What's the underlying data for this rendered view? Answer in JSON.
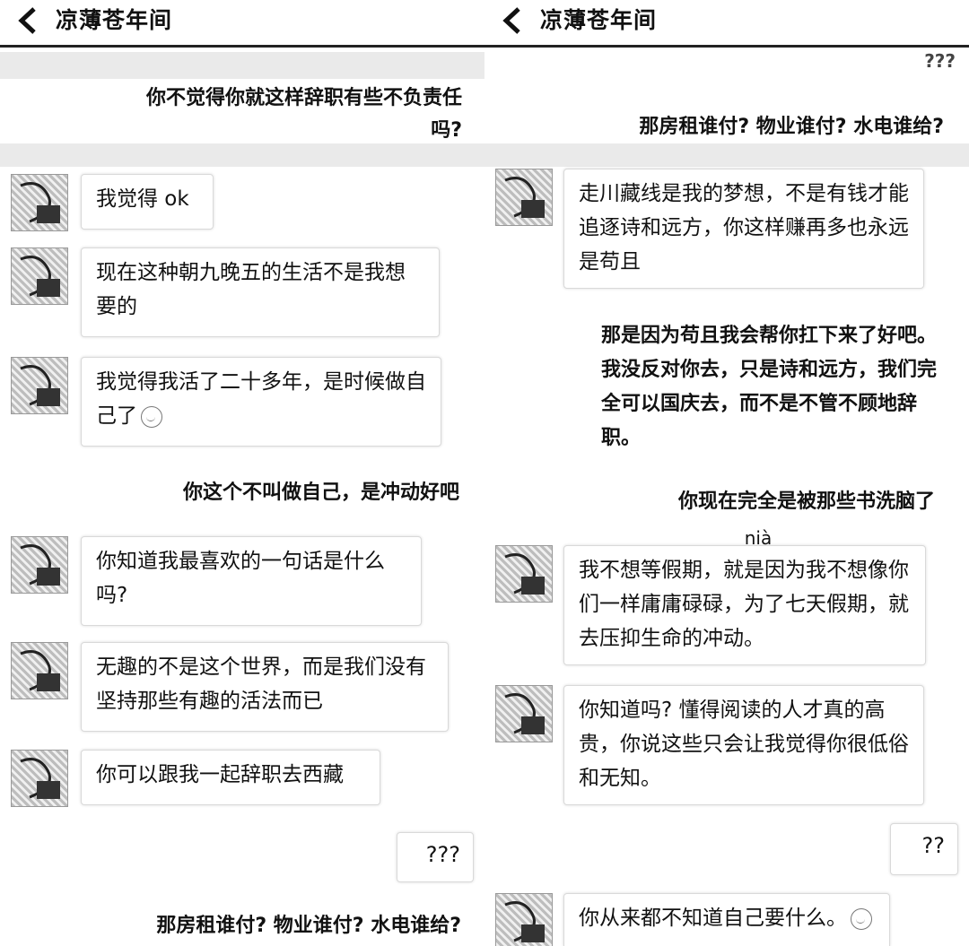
{
  "left_panel": {
    "header": {
      "title": "凉薄苍年间"
    },
    "messages": {
      "s1": "你不觉得你就这样辞职有些不负责任吗?",
      "r1": "我觉得 ok",
      "r2": "现在这种朝九晚五的生活不是我想要的",
      "r3": "我觉得我活了二十多年，是时候做自己了",
      "s2": "你这个不叫做自己，是冲动好吧",
      "r4": "你知道我最喜欢的一句话是什么吗?",
      "r5": "无趣的不是这个世界，而是我们没有坚持那些有趣的活法而已",
      "r6": "你可以跟我一起辞职去西藏",
      "s3": "???",
      "s4": "那房租谁付? 物业谁付? 水电谁给?"
    }
  },
  "right_panel": {
    "header": {
      "title": "凉薄苍年间"
    },
    "messages": {
      "top": "???",
      "s1": "那房租谁付? 物业谁付? 水电谁给?",
      "r1": "走川藏线是我的梦想，不是有钱才能追逐诗和远方，你这样赚再多也永远是苟且",
      "s2": "那是因为苟且我会帮你扛下来了好吧。我没反对你去，只是诗和远方，我们完全可以国庆去，而不是不管不顾地辞职。",
      "s3": "你现在完全是被那些书洗脑了",
      "s3b": "nià",
      "r2": "我不想等假期，就是因为我不想像你们一样庸庸碌碌，为了七天假期，就去压抑生命的冲动。",
      "r3": "你知道吗? 懂得阅读的人才真的高贵，你说这些只会让我觉得你很低俗和无知。",
      "s4": "??",
      "r4": "你从来都不知道自己要什么。"
    }
  },
  "icons": {
    "back": "chevron-left-icon",
    "avatar": "avatar-image",
    "emoji": "smile-emoji-icon"
  }
}
